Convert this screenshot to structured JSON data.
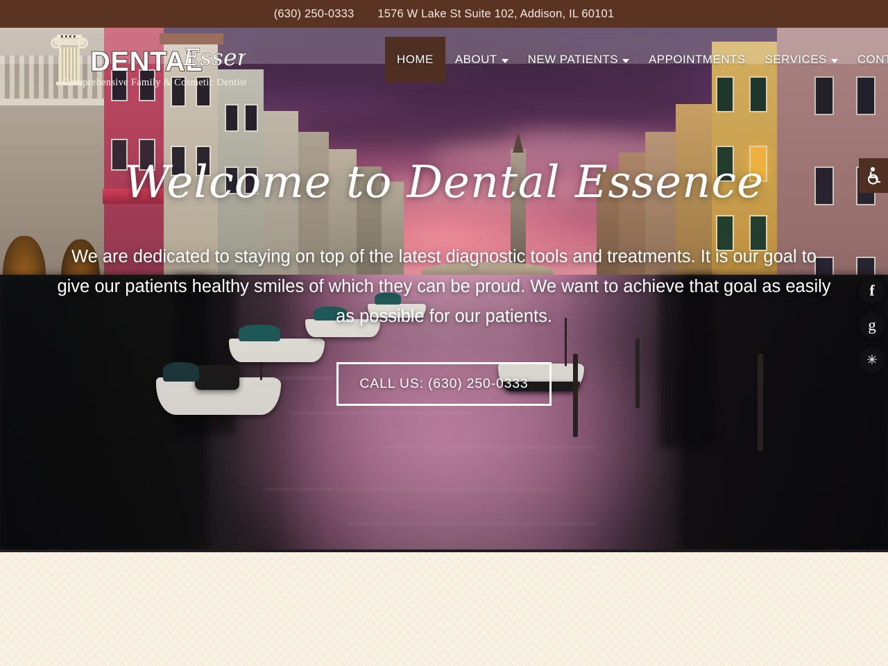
{
  "site": {
    "name": "Dental Essence",
    "logo_word_1": "DENTAL",
    "logo_word_2": "Essence",
    "logo_tagline": "Comprehensive Family & Cosmetic Dentistry",
    "logo_icon": "ionic-column-icon"
  },
  "topbar": {
    "phone": "(630) 250-0333",
    "address": "1576 W Lake St Suite 102, Addison, IL 60101"
  },
  "nav": {
    "items": [
      {
        "label": "HOME",
        "active": true,
        "has_dropdown": false
      },
      {
        "label": "ABOUT",
        "active": false,
        "has_dropdown": true
      },
      {
        "label": "NEW PATIENTS",
        "active": false,
        "has_dropdown": true
      },
      {
        "label": "APPOINTMENTS",
        "active": false,
        "has_dropdown": false
      },
      {
        "label": "SERVICES",
        "active": false,
        "has_dropdown": true
      },
      {
        "label": "CONTACT",
        "active": false,
        "has_dropdown": false
      }
    ]
  },
  "hero": {
    "title": "Welcome to Dental Essence",
    "subtitle": "We are dedicated to staying on top of the latest diagnostic tools and treatments. It is our goal to give our patients healthy smiles of which they can be proud. We want to achieve that goal as easily as possible for our patients.",
    "cta_label": "CALL US: (630) 250-0333",
    "background_description": "Venetian canal at dusk with purple sky, moored boats and reflections"
  },
  "accessibility": {
    "tab_icon": "wheelchair-accessibility-icon",
    "tab_title": "Accessibility Options"
  },
  "social": [
    {
      "name": "facebook",
      "glyph": "f"
    },
    {
      "name": "google",
      "glyph": "g"
    },
    {
      "name": "yelp",
      "glyph": "✳"
    }
  ],
  "colors": {
    "topbar_brown": "#5a3322",
    "accent_dark_brown": "#4e2f22",
    "hero_text": "#ffffff",
    "section_cream": "#f7f2e4",
    "social_dark": "#111012"
  }
}
